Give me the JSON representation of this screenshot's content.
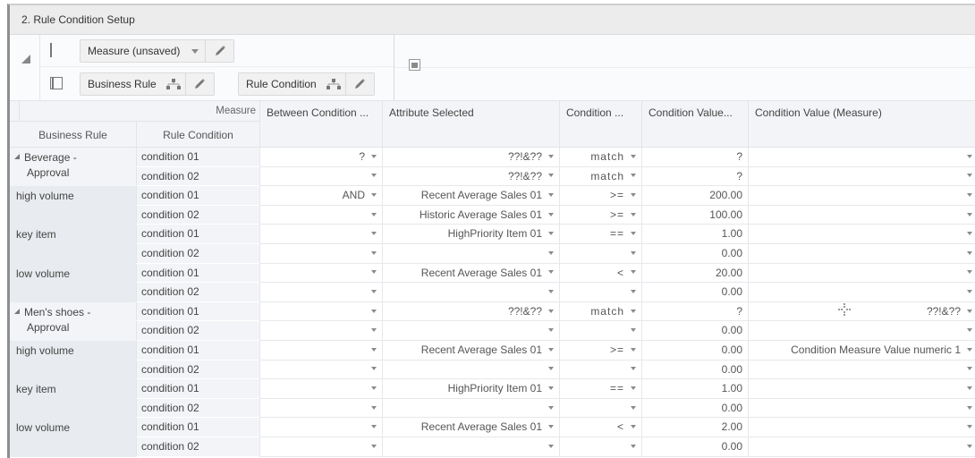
{
  "panel": {
    "title": "2. Rule Condition Setup"
  },
  "toolbar": {
    "row1": {
      "layout_icon": "rows-layout-icon",
      "measure_tile": {
        "label": "Measure (unsaved)",
        "dropdown_icon": "chevron-down-icon",
        "edit_icon": "pencil-icon"
      }
    },
    "row2": {
      "layout_icon": "columns-layout-icon",
      "tiles": [
        {
          "label": "Business Rule",
          "hierarchy_icon": "hierarchy-icon",
          "edit_icon": "pencil-icon"
        },
        {
          "label": "Rule Condition",
          "hierarchy_icon": "hierarchy-icon",
          "edit_icon": "pencil-icon"
        }
      ]
    },
    "right_icon": "pivot-area-icon"
  },
  "grid": {
    "measure_label": "Measure",
    "dimension_headers": [
      "Business Rule",
      "Rule Condition"
    ],
    "columns": [
      "Between Condition ...",
      "Attribute Selected",
      "Condition ...",
      "Condition Value...",
      "Condition Value (Measure)"
    ],
    "groups": [
      {
        "label_line1": "Beverage -",
        "label_line2": "Approval",
        "is_parent": true,
        "expanded": true,
        "rows": 2
      },
      {
        "label_line1": "high volume",
        "label_line2": "",
        "is_parent": false,
        "rows": 2
      },
      {
        "label_line1": "key item",
        "label_line2": "",
        "is_parent": false,
        "rows": 2
      },
      {
        "label_line1": "low volume",
        "label_line2": "",
        "is_parent": false,
        "rows": 2
      },
      {
        "label_line1": "Men's shoes -",
        "label_line2": "Approval",
        "is_parent": true,
        "expanded": true,
        "rows": 2
      },
      {
        "label_line1": "high volume",
        "label_line2": "",
        "is_parent": false,
        "rows": 2
      },
      {
        "label_line1": "key item",
        "label_line2": "",
        "is_parent": false,
        "rows": 2
      },
      {
        "label_line1": "low volume",
        "label_line2": "",
        "is_parent": false,
        "rows": 2
      }
    ],
    "rows": [
      {
        "condition": "condition 01",
        "between": "?",
        "attribute": "??!&??",
        "operator": "match",
        "value": "?",
        "measure_value": ""
      },
      {
        "condition": "condition 02",
        "between": "",
        "attribute": "??!&??",
        "operator": "match",
        "value": "?",
        "measure_value": ""
      },
      {
        "condition": "condition 01",
        "between": "AND",
        "attribute": "Recent Average Sales 01",
        "operator": ">=",
        "value": "200.00",
        "measure_value": ""
      },
      {
        "condition": "condition 02",
        "between": "",
        "attribute": "Historic Average Sales 01",
        "operator": ">=",
        "value": "100.00",
        "measure_value": ""
      },
      {
        "condition": "condition 01",
        "between": "",
        "attribute": "HighPriority Item 01",
        "operator": "==",
        "value": "1.00",
        "measure_value": ""
      },
      {
        "condition": "condition 02",
        "between": "",
        "attribute": "",
        "operator": "",
        "value": "0.00",
        "measure_value": ""
      },
      {
        "condition": "condition 01",
        "between": "",
        "attribute": "Recent Average Sales 01",
        "operator": "<",
        "value": "20.00",
        "measure_value": ""
      },
      {
        "condition": "condition 02",
        "between": "",
        "attribute": "",
        "operator": "",
        "value": "0.00",
        "measure_value": ""
      },
      {
        "condition": "condition 01",
        "between": "",
        "attribute": "??!&??",
        "operator": "match",
        "value": "?",
        "measure_value": "??!&??"
      },
      {
        "condition": "condition 02",
        "between": "",
        "attribute": "",
        "operator": "",
        "value": "0.00",
        "measure_value": ""
      },
      {
        "condition": "condition 01",
        "between": "",
        "attribute": "Recent Average Sales 01",
        "operator": ">=",
        "value": "0.00",
        "measure_value": "Condition Measure Value numeric 1"
      },
      {
        "condition": "condition 02",
        "between": "",
        "attribute": "",
        "operator": "",
        "value": "0.00",
        "measure_value": ""
      },
      {
        "condition": "condition 01",
        "between": "",
        "attribute": "HighPriority Item 01",
        "operator": "==",
        "value": "1.00",
        "measure_value": ""
      },
      {
        "condition": "condition 02",
        "between": "",
        "attribute": "",
        "operator": "",
        "value": "0.00",
        "measure_value": ""
      },
      {
        "condition": "condition 01",
        "between": "",
        "attribute": "Recent Average Sales 01",
        "operator": "<",
        "value": "2.00",
        "measure_value": ""
      },
      {
        "condition": "condition 02",
        "between": "",
        "attribute": "",
        "operator": "",
        "value": "0.00",
        "measure_value": ""
      }
    ]
  },
  "colors": {
    "title_bg": "#ececec",
    "header_bg": "#f3f4f7",
    "dimension_group_bg": "#e8ebef",
    "dropdown_arrow": "#8a8a8a"
  }
}
